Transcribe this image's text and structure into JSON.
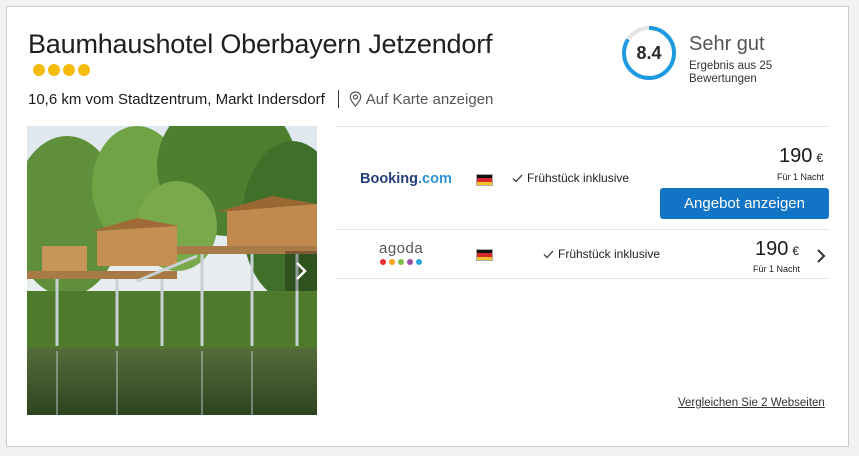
{
  "hotel": {
    "name": "Baumhaushotel Oberbayern Jetzendorf",
    "stars": 4,
    "location": "10,6 km vom Stadtzentrum, Markt Indersdorf",
    "map_link": "Auf Karte anzeigen",
    "photo_icon": "treehouse-photo"
  },
  "rating": {
    "score": "8.4",
    "score_fraction": 0.84,
    "label": "Sehr gut",
    "subtext": "Ergebnis aus 25 Bewertungen",
    "ring_color": "#1e9be0"
  },
  "offers": [
    {
      "provider_main": "Booking",
      "provider_suffix": ".com",
      "amenity": "Frühstück inklusive",
      "price": "190",
      "currency": "€",
      "per_night": "Für 1 Nacht",
      "cta": "Angebot anzeigen"
    },
    {
      "provider": "agoda",
      "amenity": "Frühstück inklusive",
      "price": "190",
      "currency": "€",
      "per_night": "Für 1 Nacht"
    }
  ],
  "compare_link": "Vergleichen Sie 2 Webseiten",
  "colors": {
    "accent": "#1174c4",
    "star": "#f5bb0d",
    "agoda_dots": [
      "#e4322b",
      "#f6a11c",
      "#7bbf44",
      "#9a4ea0",
      "#2aa9e0"
    ]
  }
}
